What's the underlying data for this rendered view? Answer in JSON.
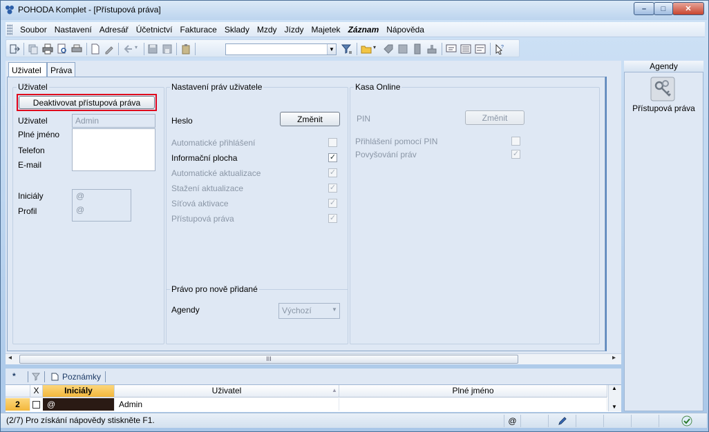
{
  "window": {
    "title": "POHODA Komplet - [Přístupová práva]",
    "min": "–",
    "max": "□",
    "close": "✕"
  },
  "menu": [
    "Soubor",
    "Nastavení",
    "Adresář",
    "Účetnictví",
    "Fakturace",
    "Sklady",
    "Mzdy",
    "Jízdy",
    "Majetek",
    "Záznam",
    "Nápověda"
  ],
  "tabs": {
    "uzivatel": "Uživatel",
    "prava": "Práva"
  },
  "user_group": {
    "title": "Uživatel",
    "deactivate_button": "Deaktivovat přístupová práva",
    "label_user": "Uživatel",
    "value_user": "Admin",
    "label_fullname": "Plné jméno",
    "label_phone": "Telefon",
    "label_email": "E-mail",
    "label_initials": "Iniciály",
    "value_initials": "@",
    "label_profile": "Profil",
    "value_profile": "@"
  },
  "rights_group": {
    "title": "Nastavení práv uživatele",
    "password_label": "Heslo",
    "change_button": "Změnit",
    "items": [
      {
        "label": "Automatické přihlášení",
        "checked": false,
        "enabled": false
      },
      {
        "label": "Informační plocha",
        "checked": true,
        "enabled": true
      },
      {
        "label": "Automatické aktualizace",
        "checked": true,
        "enabled": false
      },
      {
        "label": "Stažení aktualizace",
        "checked": true,
        "enabled": false
      },
      {
        "label": "Síťová aktivace",
        "checked": true,
        "enabled": false
      },
      {
        "label": "Přístupová práva",
        "checked": true,
        "enabled": false
      }
    ]
  },
  "new_rights": {
    "title": "Právo pro nově přidané",
    "label": "Agendy",
    "select_value": "Výchozí"
  },
  "kasa": {
    "title": "Kasa Online",
    "pin_label": "PIN",
    "change_button": "Změnit",
    "items": [
      {
        "label": "Přihlášení pomocí PIN",
        "checked": false
      },
      {
        "label": "Povyšování práv",
        "checked": true
      }
    ]
  },
  "agendy": {
    "header": "Agendy",
    "item": "Přístupová práva"
  },
  "scroll": {
    "thumb": "III",
    "left": "◂",
    "right": "▸"
  },
  "lower": {
    "tab_star": "*",
    "tab_notes": "Poznámky",
    "col_x": "X",
    "col_initials": "Iniciály",
    "col_user": "Uživatel",
    "col_fullname": "Plné jméno",
    "row_num": "2",
    "row_initials": "@",
    "row_user": "Admin"
  },
  "status": {
    "text": "(2/7) Pro získání nápovědy stiskněte F1.",
    "at": "@"
  },
  "colors": {
    "accent": "#f6c04a",
    "highlight_border": "#e0001b"
  }
}
